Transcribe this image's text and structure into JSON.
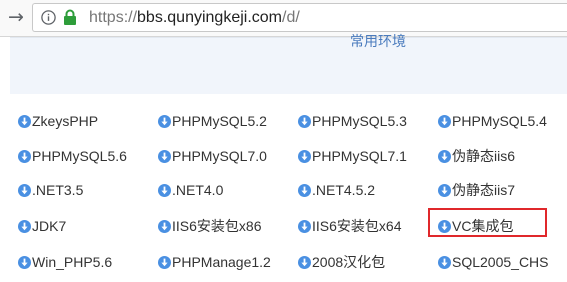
{
  "browser": {
    "back_label": "→",
    "url_scheme": "https://",
    "url_host": "bbs.qunyingkeji.com",
    "url_path": "/d/"
  },
  "section": {
    "title": "常用环境"
  },
  "downloads": {
    "rows": [
      [
        "ZkeysPHP",
        "PHPMySQL5.2",
        "PHPMySQL5.3",
        "PHPMySQL5.4"
      ],
      [
        "PHPMySQL5.6",
        "PHPMySQL7.0",
        "PHPMySQL7.1",
        "伪静态iis6"
      ],
      [
        ".NET3.5",
        ".NET4.0",
        ".NET4.5.2",
        "伪静态iis7"
      ],
      [
        "JDK7",
        "IIS6安装包x86",
        "IIS6安装包x64",
        "VC集成包"
      ],
      [
        "Win_PHP5.6",
        "PHPManage1.2",
        "2008汉化包",
        "SQL2005_CHS"
      ]
    ],
    "highlighted": "VC集成包"
  },
  "colors": {
    "accent": "#4a90e2",
    "highlight_border": "#e0282b",
    "lock": "#2e9d3a",
    "section_bg": "#f1f5fb"
  },
  "icons": {
    "back": "arrow-right-icon",
    "info": "info-icon",
    "lock": "lock-icon",
    "download": "download-icon"
  }
}
